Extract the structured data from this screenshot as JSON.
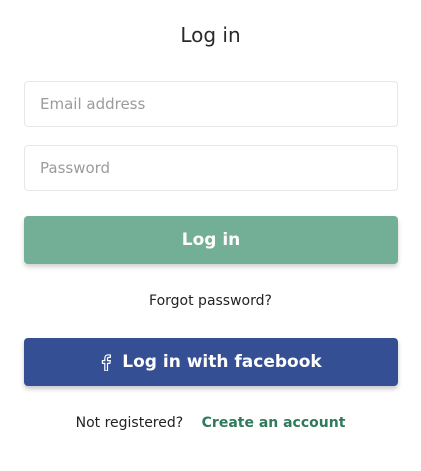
{
  "page": {
    "title": "Log in"
  },
  "form": {
    "email_placeholder": "Email address",
    "email_value": "",
    "password_placeholder": "Password",
    "password_value": "",
    "login_label": "Log in",
    "forgot_label": "Forgot password?",
    "facebook_label": "Log in with facebook",
    "facebook_icon": "facebook-f-icon"
  },
  "footer": {
    "not_registered_text": "Not registered?",
    "create_account_label": "Create an account"
  },
  "colors": {
    "login_button": "#73ae96",
    "facebook_button": "#344f93",
    "link": "#2f7a5c"
  }
}
